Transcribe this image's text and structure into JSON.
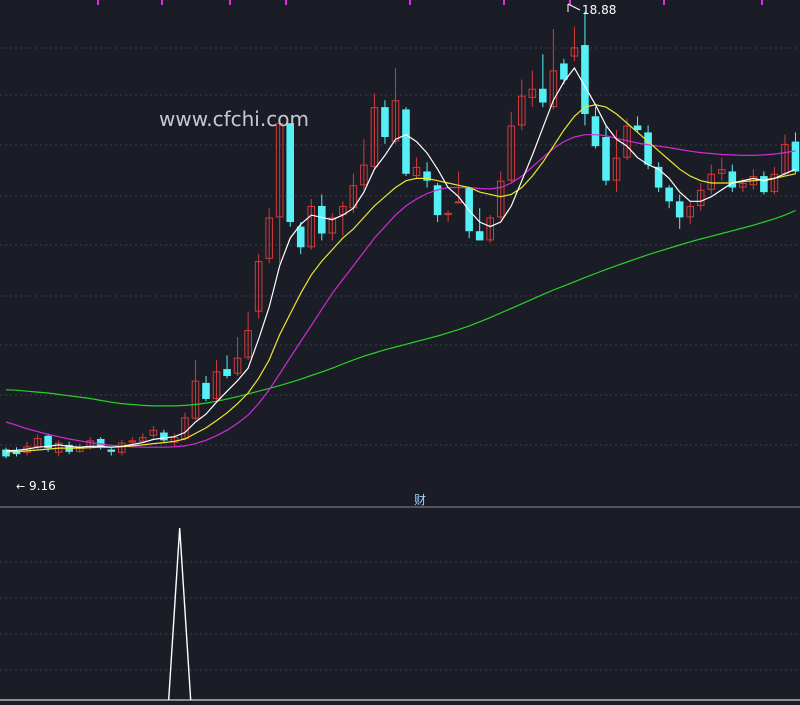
{
  "watermark": "www.cfchi.com",
  "chart_data": {
    "type": "candlestick",
    "price_range": [
      8.6,
      19.0
    ],
    "high_label": "18.88",
    "low_label": "9.16",
    "sub_indicator_label": "财",
    "colors": {
      "background": "#1b1d26",
      "up": "#d23a3a",
      "down": "#54f0f5",
      "ma_fast": "#ffffff",
      "ma_mid": "#e9e632",
      "ma_slow": "#d12ad6",
      "ma_long": "#27d227",
      "grid": "#3a3d4d",
      "label": "#ffffff",
      "top_ticks": "#e02fe0"
    },
    "candles": [
      [
        9.35,
        9.2,
        9.39,
        9.16
      ],
      [
        9.32,
        9.25,
        9.4,
        9.2
      ],
      [
        9.28,
        9.42,
        9.52,
        9.22
      ],
      [
        9.4,
        9.6,
        9.68,
        9.35
      ],
      [
        9.65,
        9.38,
        9.7,
        9.3
      ],
      [
        9.28,
        9.5,
        9.55,
        9.2
      ],
      [
        9.45,
        9.3,
        9.52,
        9.25
      ],
      [
        9.3,
        9.4,
        9.48,
        9.28
      ],
      [
        9.4,
        9.55,
        9.62,
        9.35
      ],
      [
        9.58,
        9.4,
        9.62,
        9.35
      ],
      [
        9.35,
        9.3,
        9.38,
        9.22
      ],
      [
        9.28,
        9.5,
        9.56,
        9.22
      ],
      [
        9.5,
        9.55,
        9.62,
        9.45
      ],
      [
        9.52,
        9.62,
        9.7,
        9.48
      ],
      [
        9.65,
        9.78,
        9.86,
        9.6
      ],
      [
        9.72,
        9.55,
        9.78,
        9.5
      ],
      [
        9.5,
        9.62,
        9.7,
        9.4
      ],
      [
        9.58,
        10.05,
        10.15,
        9.55
      ],
      [
        10.02,
        10.85,
        11.3,
        10.0
      ],
      [
        10.8,
        10.45,
        10.95,
        10.4
      ],
      [
        10.45,
        11.05,
        11.3,
        10.4
      ],
      [
        11.1,
        10.95,
        11.4,
        10.9
      ],
      [
        11.0,
        11.35,
        11.8,
        10.95
      ],
      [
        11.35,
        11.95,
        12.35,
        11.3
      ],
      [
        12.35,
        13.45,
        13.6,
        12.2
      ],
      [
        13.5,
        14.4,
        14.6,
        13.4
      ],
      [
        14.4,
        16.45,
        16.55,
        13.4
      ],
      [
        16.45,
        14.3,
        16.45,
        14.2
      ],
      [
        14.2,
        13.75,
        14.3,
        13.6
      ],
      [
        13.75,
        14.65,
        14.8,
        13.7
      ],
      [
        14.65,
        14.05,
        14.9,
        13.9
      ],
      [
        14.05,
        14.4,
        14.5,
        13.9
      ],
      [
        14.45,
        14.65,
        14.75,
        14.0
      ],
      [
        14.6,
        15.1,
        15.35,
        14.5
      ],
      [
        15.1,
        15.55,
        16.1,
        15.0
      ],
      [
        15.5,
        16.8,
        17.1,
        15.45
      ],
      [
        16.8,
        16.15,
        16.95,
        16.0
      ],
      [
        16.05,
        16.95,
        17.65,
        16.0
      ],
      [
        16.75,
        15.35,
        16.8,
        15.3
      ],
      [
        15.3,
        15.5,
        15.7,
        15.25
      ],
      [
        15.4,
        15.2,
        15.6,
        15.05
      ],
      [
        15.1,
        14.45,
        15.15,
        14.3
      ],
      [
        14.45,
        14.5,
        14.55,
        14.3
      ],
      [
        14.75,
        14.75,
        15.4,
        14.7
      ],
      [
        15.05,
        14.1,
        15.05,
        13.95
      ],
      [
        14.1,
        13.9,
        14.6,
        13.9
      ],
      [
        13.9,
        14.4,
        14.45,
        13.85
      ],
      [
        14.4,
        15.2,
        15.4,
        14.35
      ],
      [
        15.2,
        16.4,
        16.7,
        15.15
      ],
      [
        16.4,
        17.05,
        17.4,
        16.3
      ],
      [
        17.0,
        17.2,
        17.6,
        16.8
      ],
      [
        17.2,
        16.9,
        17.95,
        16.8
      ],
      [
        16.8,
        17.6,
        18.5,
        16.75
      ],
      [
        17.75,
        17.4,
        17.85,
        17.3
      ],
      [
        17.9,
        18.1,
        18.55,
        17.8
      ],
      [
        18.15,
        16.65,
        18.88,
        16.4
      ],
      [
        16.6,
        15.95,
        16.8,
        15.9
      ],
      [
        16.15,
        15.2,
        16.4,
        15.1
      ],
      [
        15.2,
        15.7,
        16.3,
        14.95
      ],
      [
        15.7,
        16.4,
        16.55,
        15.65
      ],
      [
        16.4,
        16.3,
        16.6,
        16.25
      ],
      [
        16.25,
        15.55,
        16.4,
        15.45
      ],
      [
        15.5,
        15.05,
        15.6,
        14.95
      ],
      [
        15.05,
        14.75,
        15.1,
        14.6
      ],
      [
        14.75,
        14.4,
        14.9,
        14.15
      ],
      [
        14.4,
        14.65,
        14.75,
        14.25
      ],
      [
        14.65,
        15.0,
        15.15,
        14.55
      ],
      [
        15.0,
        15.35,
        15.55,
        14.9
      ],
      [
        15.35,
        15.45,
        15.7,
        15.2
      ],
      [
        15.4,
        15.05,
        15.55,
        14.95
      ],
      [
        15.05,
        15.15,
        15.25,
        14.95
      ],
      [
        15.1,
        15.3,
        15.45,
        15.0
      ],
      [
        15.3,
        14.95,
        15.4,
        14.9
      ],
      [
        14.95,
        15.35,
        15.5,
        14.9
      ],
      [
        15.35,
        16.0,
        16.2,
        15.3
      ],
      [
        16.05,
        15.4,
        16.25,
        15.35
      ]
    ],
    "ma_fast": [
      9.32,
      9.33,
      9.36,
      9.4,
      9.42,
      9.45,
      9.42,
      9.4,
      9.42,
      9.42,
      9.4,
      9.42,
      9.46,
      9.5,
      9.57,
      9.6,
      9.63,
      9.72,
      9.95,
      10.12,
      10.38,
      10.62,
      10.85,
      11.12,
      11.75,
      12.45,
      13.35,
      13.95,
      14.25,
      14.45,
      14.4,
      14.35,
      14.45,
      14.6,
      14.95,
      15.45,
      15.75,
      16.1,
      16.2,
      16.05,
      15.8,
      15.45,
      15.05,
      14.85,
      14.55,
      14.3,
      14.2,
      14.3,
      14.65,
      15.2,
      15.75,
      16.35,
      16.95,
      17.35,
      17.65,
      17.25,
      16.85,
      16.4,
      16.1,
      15.95,
      15.7,
      15.55,
      15.45,
      15.25,
      14.95,
      14.75,
      14.75,
      14.85,
      15.0,
      15.15,
      15.2,
      15.25,
      15.2,
      15.25,
      15.35,
      15.45
    ],
    "ma_mid": [
      9.3,
      9.3,
      9.32,
      9.34,
      9.36,
      9.38,
      9.38,
      9.38,
      9.39,
      9.4,
      9.4,
      9.41,
      9.43,
      9.45,
      9.48,
      9.5,
      9.53,
      9.58,
      9.7,
      9.82,
      9.98,
      10.15,
      10.35,
      10.58,
      10.9,
      11.3,
      11.85,
      12.3,
      12.75,
      13.15,
      13.45,
      13.7,
      13.95,
      14.15,
      14.4,
      14.65,
      14.85,
      15.05,
      15.2,
      15.25,
      15.25,
      15.2,
      15.15,
      15.1,
      15.05,
      14.95,
      14.9,
      14.85,
      14.9,
      15.05,
      15.3,
      15.6,
      15.95,
      16.3,
      16.6,
      16.8,
      16.85,
      16.8,
      16.65,
      16.45,
      16.25,
      16.05,
      15.85,
      15.65,
      15.45,
      15.3,
      15.2,
      15.15,
      15.15,
      15.15,
      15.18,
      15.2,
      15.22,
      15.25,
      15.3,
      15.35
    ],
    "ma_slow": [
      9.95,
      9.88,
      9.8,
      9.74,
      9.68,
      9.63,
      9.58,
      9.54,
      9.5,
      9.47,
      9.44,
      9.42,
      9.41,
      9.4,
      9.4,
      9.4,
      9.41,
      9.43,
      9.48,
      9.55,
      9.65,
      9.77,
      9.92,
      10.1,
      10.35,
      10.65,
      11.0,
      11.35,
      11.7,
      12.05,
      12.4,
      12.75,
      13.05,
      13.35,
      13.65,
      13.95,
      14.2,
      14.45,
      14.65,
      14.8,
      14.92,
      15.0,
      15.05,
      15.05,
      15.05,
      15.03,
      15.02,
      15.05,
      15.15,
      15.3,
      15.5,
      15.7,
      15.9,
      16.05,
      16.15,
      16.2,
      16.2,
      16.18,
      16.12,
      16.07,
      16.02,
      15.98,
      15.95,
      15.92,
      15.88,
      15.84,
      15.81,
      15.79,
      15.77,
      15.76,
      15.75,
      15.75,
      15.76,
      15.78,
      15.81,
      15.85
    ],
    "ma_long": [
      10.65,
      10.64,
      10.62,
      10.6,
      10.58,
      10.55,
      10.52,
      10.49,
      10.46,
      10.42,
      10.38,
      10.35,
      10.33,
      10.31,
      10.3,
      10.3,
      10.3,
      10.31,
      10.33,
      10.36,
      10.4,
      10.45,
      10.5,
      10.56,
      10.62,
      10.68,
      10.74,
      10.81,
      10.88,
      10.96,
      11.04,
      11.12,
      11.21,
      11.3,
      11.38,
      11.45,
      11.52,
      11.58,
      11.64,
      11.7,
      11.76,
      11.82,
      11.89,
      11.96,
      12.04,
      12.13,
      12.22,
      12.32,
      12.42,
      12.52,
      12.62,
      12.72,
      12.82,
      12.91,
      13.0,
      13.09,
      13.18,
      13.27,
      13.35,
      13.43,
      13.51,
      13.59,
      13.66,
      13.73,
      13.8,
      13.87,
      13.93,
      13.99,
      14.05,
      14.11,
      14.17,
      14.23,
      14.3,
      14.37,
      14.45,
      14.55
    ],
    "sub_indicator": {
      "signal_index": 16,
      "values_normalized": [
        0,
        0,
        0,
        0,
        0,
        0,
        0,
        0,
        0,
        0,
        0,
        0,
        0,
        0,
        0,
        0,
        1,
        0,
        0,
        0,
        0,
        0,
        0,
        0,
        0,
        0,
        0,
        0,
        0,
        0,
        0,
        0,
        0,
        0,
        0,
        0,
        0,
        0,
        0,
        0,
        0,
        0,
        0,
        0,
        0,
        0,
        0,
        0,
        0,
        0,
        0,
        0,
        0,
        0,
        0,
        0,
        0,
        0,
        0,
        0,
        0,
        0,
        0,
        0,
        0,
        0,
        0,
        0,
        0,
        0,
        0,
        0,
        0,
        0,
        0,
        0
      ]
    }
  }
}
